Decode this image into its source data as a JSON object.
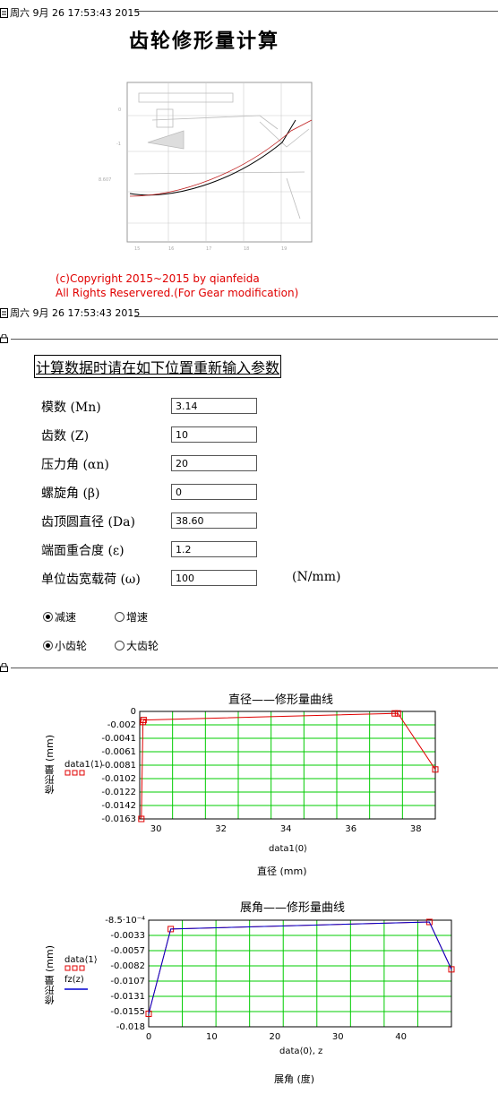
{
  "header": {
    "datetime": "周六 9月 26 17:53:43 2015"
  },
  "page": {
    "title": "齿轮修形量计算"
  },
  "copyright": {
    "line1": "(c)Copyright 2015~2015 by qianfeida",
    "line2": "All Rights Reservered.(For Gear modification)"
  },
  "header2": {
    "datetime": "周六 9月 26 17:53:43 2015"
  },
  "instruction": "计算数据时请在如下位置重新输入参数",
  "params": [
    {
      "label": "模数 (Mn)",
      "value": "3.14"
    },
    {
      "label": "齿数 (Z)",
      "value": "10"
    },
    {
      "label": "压力角 (αn)",
      "value": "20"
    },
    {
      "label": "螺旋角 (β)",
      "value": "0"
    },
    {
      "label": "齿顶圆直径 (Da)",
      "value": "38.60"
    },
    {
      "label": "端面重合度 (ε)",
      "value": "1.2"
    },
    {
      "label": "单位齿宽载荷 (ω)",
      "value": "100",
      "unit": "(N/mm)"
    }
  ],
  "radios": {
    "speed": {
      "options": [
        "减速",
        "增速"
      ],
      "selected": 0
    },
    "gear": {
      "options": [
        "小齿轮",
        "大齿轮"
      ],
      "selected": 0
    }
  },
  "chart_data": [
    {
      "type": "line",
      "title": "直径——修形量曲线",
      "xlabel": "直径 (mm)",
      "xvar": "data1⟨0⟩",
      "ylabel": "修形量 (mm)",
      "legend": [
        "data1⟨1⟩"
      ],
      "xlim": [
        29.5,
        38.6
      ],
      "ylim": [
        -0.0163,
        0
      ],
      "xticks": [
        "30",
        "32",
        "34",
        "36",
        "38"
      ],
      "yticks": [
        "0",
        "-0.002",
        "-0.0041",
        "-0.0061",
        "-0.0081",
        "-0.0102",
        "-0.0122",
        "-0.0142",
        "-0.0163"
      ],
      "series": [
        {
          "name": "data1⟨1⟩",
          "color": "#e00000",
          "x": [
            29.55,
            29.6,
            29.62,
            37.35,
            37.45,
            38.6
          ],
          "y": [
            -0.0163,
            -0.0016,
            -0.0013,
            -0.0003,
            -0.0003,
            -0.0088
          ]
        }
      ],
      "grid": true
    },
    {
      "type": "line",
      "title": "展角——修形量曲线",
      "xlabel": "展角 (度)",
      "xvar": "data⟨0⟩, z",
      "ylabel": "修形量 (mm)",
      "legend": [
        "data⟨1⟩",
        "fz(z)"
      ],
      "xlim": [
        0,
        48
      ],
      "ylim": [
        -0.018,
        0
      ],
      "xticks": [
        "0",
        "10",
        "20",
        "30",
        "40"
      ],
      "yticks": [
        "-8.5·10⁻⁴",
        "-0.0033",
        "-0.0057",
        "-0.0082",
        "-0.0107",
        "-0.0131",
        "-0.0155",
        "-0.018"
      ],
      "series": [
        {
          "name": "data⟨1⟩",
          "color": "#e00000",
          "x": [
            0,
            3.5,
            44.5,
            48
          ],
          "y": [
            -0.0158,
            -0.0015,
            -0.0003,
            -0.0083
          ]
        },
        {
          "name": "fz(z)",
          "color": "#0000d0",
          "x": [
            0,
            3.5,
            44.5,
            48
          ],
          "y": [
            -0.0158,
            -0.0015,
            -0.0003,
            -0.0083
          ]
        }
      ],
      "grid": true
    }
  ],
  "colors": {
    "copyright": "#e00000",
    "grid": "#00cc00",
    "series_red": "#e00000",
    "series_blue": "#0000d0"
  }
}
